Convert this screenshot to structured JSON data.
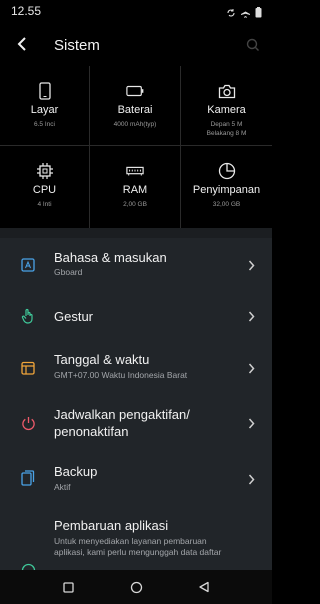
{
  "status": {
    "time": "12.55",
    "icons": [
      "sync-icon",
      "airplane-icon",
      "battery-icon"
    ]
  },
  "appbar": {
    "title": "Sistem"
  },
  "specs": [
    {
      "icon": "phone-icon",
      "label": "Layar",
      "sub": "6.5 Inci"
    },
    {
      "icon": "battery-icon",
      "label": "Baterai",
      "sub": "4000 mAh(typ)"
    },
    {
      "icon": "camera-icon",
      "label": "Kamera",
      "sub": "Depan 5 M",
      "sub2": "Belakang 8 M"
    },
    {
      "icon": "cpu-icon",
      "label": "CPU",
      "sub": "4 Inti"
    },
    {
      "icon": "ram-icon",
      "label": "RAM",
      "sub": "2,00 GB"
    },
    {
      "icon": "storage-icon",
      "label": "Penyimpanan",
      "sub": "32,00 GB"
    }
  ],
  "items": [
    {
      "icon": "keyboard-icon",
      "title": "Bahasa & masukan",
      "sub": "Gboard",
      "color": "#4aa3e8"
    },
    {
      "icon": "gesture-hand-icon",
      "title": "Gestur",
      "sub": "",
      "color": "#3fc99a"
    },
    {
      "icon": "calendar-icon",
      "title": "Tanggal & waktu",
      "sub": "GMT+07.00 Waktu Indonesia Barat",
      "color": "#f0a53a"
    },
    {
      "icon": "power-icon",
      "title": "Jadwalkan pengaktifan/ penonaktifan",
      "sub": "",
      "color": "#ef5a6a"
    },
    {
      "icon": "backup-icon",
      "title": "Backup",
      "sub": "Aktif",
      "color": "#4aa3e8"
    },
    {
      "icon": "update-icon",
      "title": "Pembaruan aplikasi",
      "sub": "Untuk menyediakan layanan pembaruan aplikasi, kami perlu mengunggah data daftar",
      "color": "#3fc99a"
    }
  ],
  "colors": {
    "background": "#000000",
    "list_bg": "#212529",
    "accent_blue": "#4aa3e8"
  }
}
